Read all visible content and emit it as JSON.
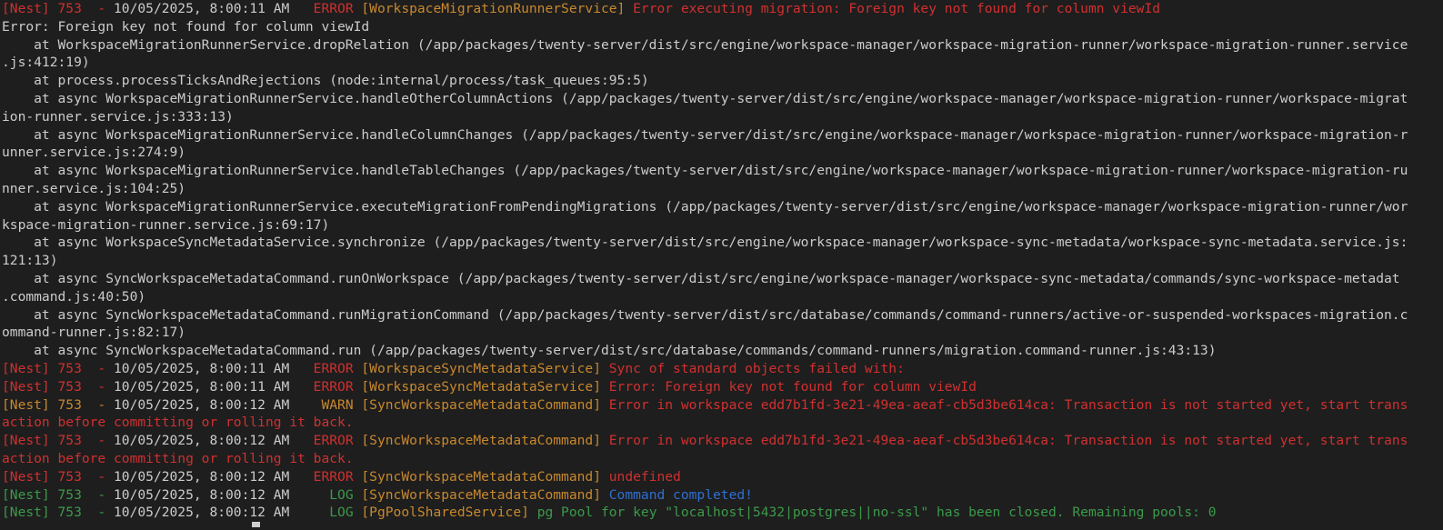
{
  "colors": {
    "background": "#1e1e1e",
    "error": "#d03030",
    "warn": "#c8882e",
    "context": "#c8882e",
    "log": "#3c9a4a",
    "completed": "#2f6fd0",
    "stack": "#cccccc"
  },
  "lines": [
    {
      "t": "log",
      "prefix": "[Nest] 753  - ",
      "ts": "10/05/2025, 8:00:11 AM",
      "level": "   ERROR ",
      "ctx": "[WorkspaceMigrationRunnerService]",
      "msg": " Error executing migration: Foreign key not found for column viewId",
      "pc": "c-red",
      "mc": "c-red"
    },
    {
      "t": "text",
      "text": "Error: Foreign key not found for column viewId"
    },
    {
      "t": "text",
      "text": "    at WorkspaceMigrationRunnerService.dropRelation (/app/packages/twenty-server/dist/src/engine/workspace-manager/workspace-migration-runner/workspace-migration-runner.service"
    },
    {
      "t": "text",
      "text": ".js:412:19)"
    },
    {
      "t": "text",
      "text": "    at process.processTicksAndRejections (node:internal/process/task_queues:95:5)"
    },
    {
      "t": "text",
      "text": "    at async WorkspaceMigrationRunnerService.handleOtherColumnActions (/app/packages/twenty-server/dist/src/engine/workspace-manager/workspace-migration-runner/workspace-migrat"
    },
    {
      "t": "text",
      "text": "ion-runner.service.js:333:13)"
    },
    {
      "t": "text",
      "text": "    at async WorkspaceMigrationRunnerService.handleColumnChanges (/app/packages/twenty-server/dist/src/engine/workspace-manager/workspace-migration-runner/workspace-migration-r"
    },
    {
      "t": "text",
      "text": "unner.service.js:274:9)"
    },
    {
      "t": "text",
      "text": "    at async WorkspaceMigrationRunnerService.handleTableChanges (/app/packages/twenty-server/dist/src/engine/workspace-manager/workspace-migration-runner/workspace-migration-ru"
    },
    {
      "t": "text",
      "text": "nner.service.js:104:25)"
    },
    {
      "t": "text",
      "text": "    at async WorkspaceMigrationRunnerService.executeMigrationFromPendingMigrations (/app/packages/twenty-server/dist/src/engine/workspace-manager/workspace-migration-runner/wor"
    },
    {
      "t": "text",
      "text": "kspace-migration-runner.service.js:69:17)"
    },
    {
      "t": "text",
      "text": "    at async WorkspaceSyncMetadataService.synchronize (/app/packages/twenty-server/dist/src/engine/workspace-manager/workspace-sync-metadata/workspace-sync-metadata.service.js:"
    },
    {
      "t": "text",
      "text": "121:13)"
    },
    {
      "t": "text",
      "text": "    at async SyncWorkspaceMetadataCommand.runOnWorkspace (/app/packages/twenty-server/dist/src/engine/workspace-manager/workspace-sync-metadata/commands/sync-workspace-metadat"
    },
    {
      "t": "text",
      "text": ".command.js:40:50)"
    },
    {
      "t": "text",
      "text": "    at async SyncWorkspaceMetadataCommand.runMigrationCommand (/app/packages/twenty-server/dist/src/database/commands/command-runners/active-or-suspended-workspaces-migration.c"
    },
    {
      "t": "text",
      "text": "ommand-runner.js:82:17)"
    },
    {
      "t": "text",
      "text": "    at async SyncWorkspaceMetadataCommand.run (/app/packages/twenty-server/dist/src/database/commands/command-runners/migration.command-runner.js:43:13)"
    },
    {
      "t": "log",
      "prefix": "[Nest] 753  - ",
      "ts": "10/05/2025, 8:00:11 AM",
      "level": "   ERROR ",
      "ctx": "[WorkspaceSyncMetadataService]",
      "msg": " Sync of standard objects failed with:",
      "pc": "c-red",
      "mc": "c-red"
    },
    {
      "t": "log",
      "prefix": "[Nest] 753  - ",
      "ts": "10/05/2025, 8:00:11 AM",
      "level": "   ERROR ",
      "ctx": "[WorkspaceSyncMetadataService]",
      "msg": " Error: Foreign key not found for column viewId",
      "pc": "c-red",
      "mc": "c-red"
    },
    {
      "t": "log",
      "prefix": "[Nest] 753  - ",
      "ts": "10/05/2025, 8:00:12 AM",
      "level": "    WARN ",
      "ctx": "[SyncWorkspaceMetadataCommand]",
      "msg": " Error in workspace edd7b1fd-3e21-49ea-aeaf-cb5d3be614ca: Transaction is not started yet, start trans",
      "pc": "c-orange",
      "mc": "c-red"
    },
    {
      "t": "cont",
      "text": "action before committing or rolling it back.",
      "mc": "c-red"
    },
    {
      "t": "log",
      "prefix": "[Nest] 753  - ",
      "ts": "10/05/2025, 8:00:12 AM",
      "level": "   ERROR ",
      "ctx": "[SyncWorkspaceMetadataCommand]",
      "msg": " Error in workspace edd7b1fd-3e21-49ea-aeaf-cb5d3be614ca: Transaction is not started yet, start trans",
      "pc": "c-red",
      "mc": "c-red"
    },
    {
      "t": "cont",
      "text": "action before committing or rolling it back.",
      "mc": "c-red"
    },
    {
      "t": "log",
      "prefix": "[Nest] 753  - ",
      "ts": "10/05/2025, 8:00:12 AM",
      "level": "   ERROR ",
      "ctx": "[SyncWorkspaceMetadataCommand]",
      "msg": " undefined",
      "pc": "c-red",
      "mc": "c-red"
    },
    {
      "t": "log",
      "prefix": "[Nest] 753  - ",
      "ts": "10/05/2025, 8:00:12 AM",
      "level": "     LOG ",
      "ctx": "[SyncWorkspaceMetadataCommand]",
      "msg": " Command completed!",
      "pc": "c-green",
      "mc": "c-blue"
    },
    {
      "t": "log",
      "prefix": "[Nest] 753  - ",
      "ts": "10/05/2025, 8:00:12 AM",
      "level": "     LOG ",
      "ctx": "[PgPoolSharedService]",
      "msg": " pg Pool for key \"localhost|5432|postgres||no-ssl\" has been closed. Remaining pools: 0",
      "pc": "c-green",
      "mc": "c-green"
    }
  ]
}
